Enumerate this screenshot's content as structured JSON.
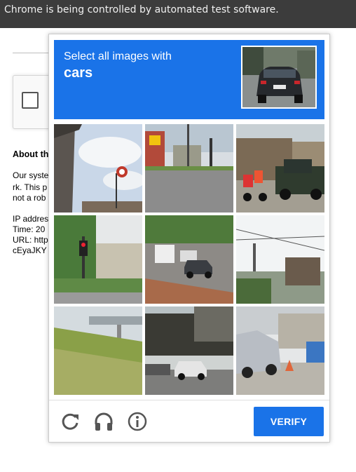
{
  "infobar": {
    "text": "Chrome is being controlled by automated test software."
  },
  "background_page": {
    "about_heading": "About th",
    "lines": [
      "Our syste",
      "rk. This p",
      "not a rob",
      "",
      "IP addres",
      "Time: 20",
      "URL: http",
      "cEyaJKY"
    ]
  },
  "captcha": {
    "instruction_line1": "Select all images with",
    "instruction_target": "cars",
    "tiles": [
      {
        "name": "tile-1",
        "content": "overpass-and-sign"
      },
      {
        "name": "tile-2",
        "content": "street-intersection"
      },
      {
        "name": "tile-3",
        "content": "motorbikes-and-truck"
      },
      {
        "name": "tile-4",
        "content": "traffic-light-trees"
      },
      {
        "name": "tile-5",
        "content": "road-with-cars"
      },
      {
        "name": "tile-6",
        "content": "power-lines-street"
      },
      {
        "name": "tile-7",
        "content": "grass-hill-bridge"
      },
      {
        "name": "tile-8",
        "content": "parked-cars-street"
      },
      {
        "name": "tile-9",
        "content": "car-at-sidewalk"
      }
    ],
    "footer": {
      "reload_icon": "reload-icon",
      "audio_icon": "headphones-icon",
      "info_icon": "info-icon",
      "verify_label": "VERIFY"
    },
    "colors": {
      "accent": "#1a73e8"
    }
  }
}
